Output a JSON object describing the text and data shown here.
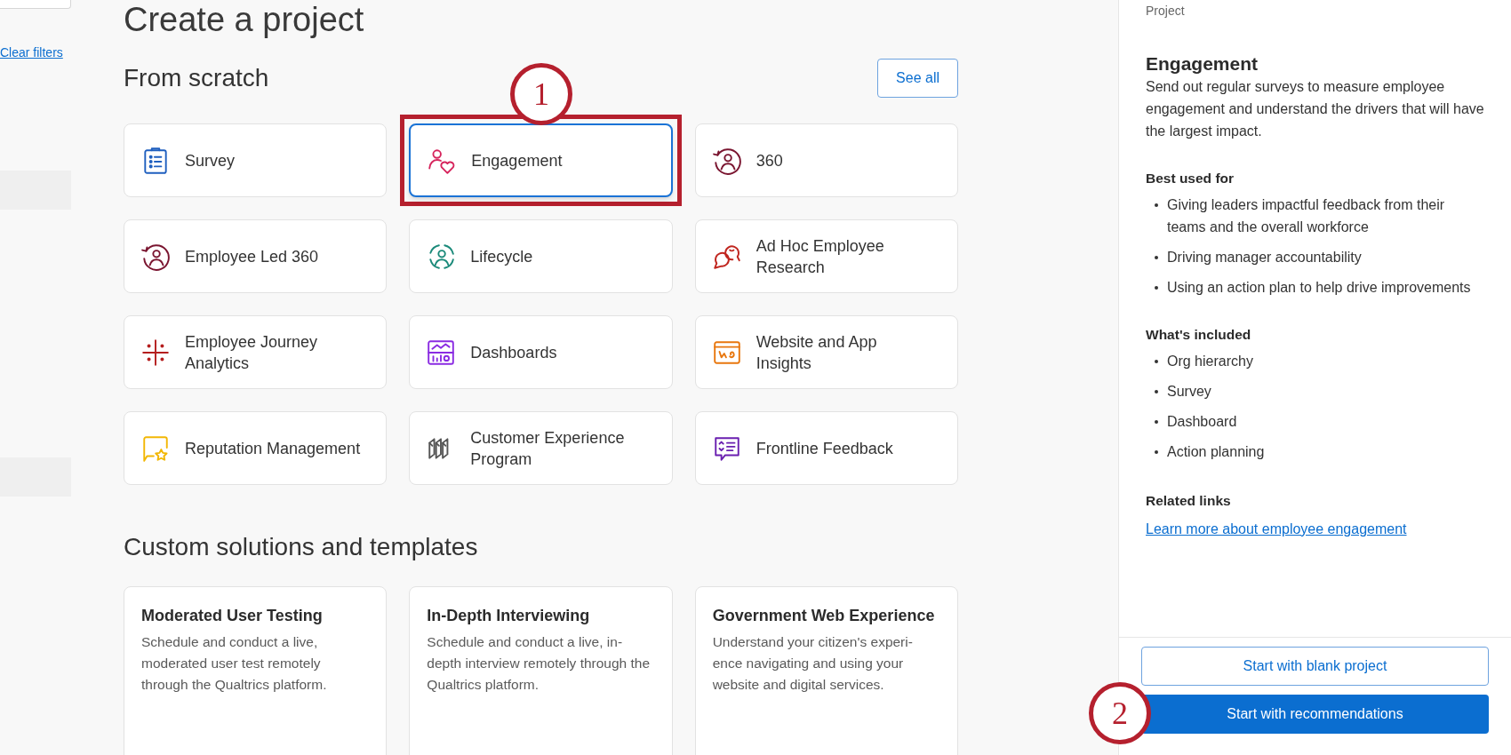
{
  "sidebar": {
    "clear_filters": "Clear filters"
  },
  "page_title": "Create a project",
  "from_scratch": {
    "heading": "From scratch",
    "see_all": "See all",
    "cards": [
      {
        "label": "Survey",
        "kind": "clipboard",
        "selected": false,
        "highlighted": false
      },
      {
        "label": "Engagement",
        "kind": "person-heart",
        "selected": true,
        "highlighted": true
      },
      {
        "label": "360",
        "kind": "person-cycle",
        "selected": false,
        "highlighted": false
      },
      {
        "label": "Employee Led 360",
        "kind": "person-cycle",
        "selected": false,
        "highlighted": false
      },
      {
        "label": "Lifecycle",
        "kind": "person-ring",
        "selected": false,
        "highlighted": false
      },
      {
        "label": "Ad Hoc Employee Research",
        "kind": "chat-bubbles",
        "selected": false,
        "highlighted": false
      },
      {
        "label": "Employee Journey Analytics",
        "kind": "sparkle-cross",
        "selected": false,
        "highlighted": false
      },
      {
        "label": "Dashboards",
        "kind": "dashboard",
        "selected": false,
        "highlighted": false
      },
      {
        "label": "Website and App Insights",
        "kind": "browser",
        "selected": false,
        "highlighted": false
      },
      {
        "label": "Reputation Management",
        "kind": "chat-star",
        "selected": false,
        "highlighted": false
      },
      {
        "label": "Customer Experience Program",
        "kind": "layers",
        "selected": false,
        "highlighted": false
      },
      {
        "label": "Frontline Feedback",
        "kind": "chat-list",
        "selected": false,
        "highlighted": false
      }
    ]
  },
  "custom": {
    "heading": "Custom solutions and templates",
    "cards": [
      {
        "title": "Moderated User Testing",
        "description": "Schedule and conduct a live, moderated user test remotely through the Qualtrics platform."
      },
      {
        "title": "In-Depth Interviewing",
        "description": "Schedule and conduct a live, in-depth interview remotely through the Qualtrics platform."
      },
      {
        "title": "Government Web Experience",
        "description": "Understand your citizen's experi-ence navigating and using your website and digital services."
      }
    ]
  },
  "details": {
    "category": "Project",
    "title": "Engagement",
    "description": "Send out regular surveys to measure employee engagement and understand the drivers that will have the largest impact.",
    "sections": [
      {
        "heading": "Best used for",
        "items": [
          "Giving leaders impactful feedback from their teams and the overall workforce",
          "Driving manager accountability",
          "Using an action plan to help drive improvements"
        ]
      },
      {
        "heading": "What's included",
        "items": [
          "Org hierarchy",
          "Survey",
          "Dashboard",
          "Action planning"
        ]
      }
    ],
    "related": {
      "heading": "Related links",
      "link": "Learn more about employee engagement"
    },
    "buttons": [
      {
        "label": "Start with blank project",
        "kind": "secondary"
      },
      {
        "label": "Start with recommendations",
        "kind": "primary"
      }
    ]
  },
  "callouts": [
    {
      "number": "1"
    },
    {
      "number": "2"
    }
  ]
}
